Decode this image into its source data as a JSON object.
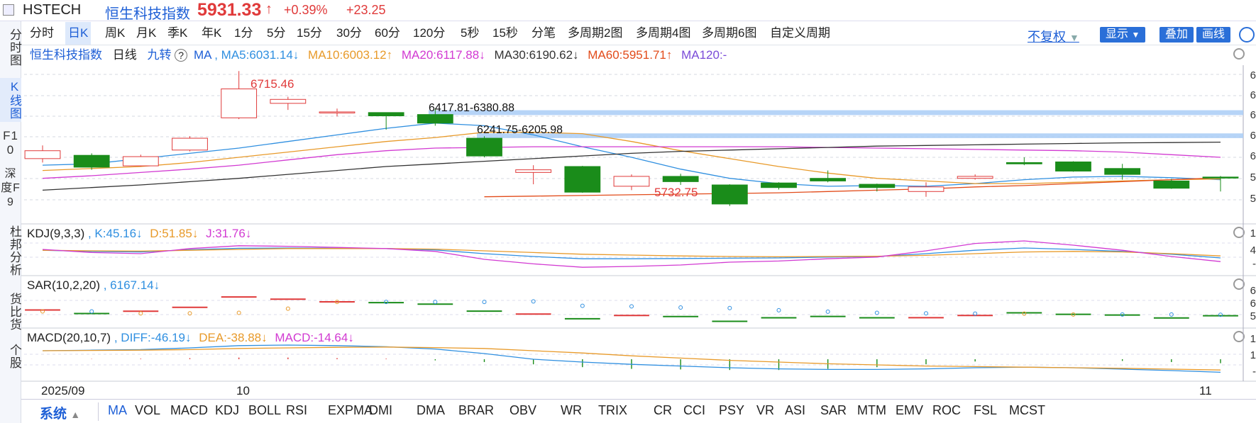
{
  "header": {
    "code": "HSTECH",
    "name": "恒生科技指数",
    "price": "5931.33",
    "price_arrow": "↑",
    "change_pct": "+0.39%",
    "change_val": "+23.25"
  },
  "sidebar": {
    "items": [
      "分时图",
      "K线图",
      "F10",
      "深度F9",
      "杜邦分析",
      "货比货",
      "个股"
    ]
  },
  "tabs": [
    "分时",
    "日K",
    "周K",
    "月K",
    "季K",
    "年K",
    "1分",
    "5分",
    "15分",
    "30分",
    "60分",
    "120分",
    "5秒",
    "15秒",
    "分笔",
    "多周期2图",
    "多周期4图",
    "多周期6图",
    "自定义周期"
  ],
  "toolbar": {
    "adjust": "不复权",
    "display": "显示",
    "overlay": "叠加",
    "draw": "画线"
  },
  "main_legend": {
    "name": "恒生科技指数",
    "period": "日线",
    "jiuzhuan": "九转",
    "help": "?",
    "ma": "MA",
    "ma5": ", MA5:6031.14↓",
    "ma10": "MA10:6003.12↑",
    "ma20": "MA20:6117.88↓",
    "ma30": "MA30:6190.62↓",
    "ma60": "MA60:5951.71↑",
    "ma120": "MA120:-"
  },
  "annotations": {
    "high": "6715.46",
    "low": "5732.75",
    "zone1": "6417.81-6380.88",
    "zone2": "6241.75-6205.98"
  },
  "kdj_legend": {
    "title": "KDJ(9,3,3)",
    "k": ", K:45.16↓",
    "d": "D:51.85↓",
    "j": "J:31.76↓"
  },
  "sar_legend": {
    "title": "SAR(10,2,20)",
    "value": ", 6167.14↓"
  },
  "macd_legend": {
    "title": "MACD(20,10,7)",
    "diff": ", DIFF:-46.19↓",
    "dea": "DEA:-38.88↓",
    "macd": "MACD:-14.64↓"
  },
  "date_axis": {
    "d1": "2025/09",
    "d2": "10",
    "d3": "11"
  },
  "axis_right": [
    "6",
    "6",
    "6",
    "6",
    "6",
    "5",
    "5",
    "1",
    "4",
    "-",
    "6",
    "6",
    "5",
    "1",
    "1",
    "-"
  ],
  "bottom": {
    "system": "系统",
    "indicators": [
      "MA",
      "VOL",
      "MACD",
      "KDJ",
      "BOLL",
      "RSI",
      "EXPMA",
      "DMI",
      "DMA",
      "BRAR",
      "OBV",
      "WR",
      "TRIX",
      "CR",
      "CCI",
      "PSY",
      "VR",
      "ASI",
      "SAR",
      "MTM",
      "EMV",
      "ROC",
      "FSL",
      "MCST"
    ]
  },
  "colors": {
    "up": "#e03a3a",
    "down": "#1a8c1a",
    "ma5": "#2f8fe0",
    "ma10": "#e89a2a",
    "ma20": "#d23ad2",
    "ma30": "#333333",
    "ma60": "#e24b1a",
    "ma120": "#7a4bd8",
    "accent": "#1e5fd6"
  },
  "chart_data": {
    "type": "candlestick",
    "candles": [
      {
        "o": 6050,
        "c": 6110,
        "h": 6150,
        "l": 6020
      },
      {
        "o": 6075,
        "c": 5985,
        "h": 6090,
        "l": 5965
      },
      {
        "o": 5995,
        "c": 6065,
        "h": 6080,
        "l": 5990
      },
      {
        "o": 6115,
        "c": 6205,
        "h": 6220,
        "l": 6105
      },
      {
        "o": 6360,
        "c": 6580,
        "h": 6715.46,
        "l": 6350
      },
      {
        "o": 6470,
        "c": 6500,
        "h": 6520,
        "l": 6420
      },
      {
        "o": 6400,
        "c": 6405,
        "h": 6430,
        "l": 6370
      },
      {
        "o": 6400,
        "c": 6375,
        "h": 6400,
        "l": 6270
      },
      {
        "o": 6385,
        "c": 6320,
        "h": 6430,
        "l": 6300
      },
      {
        "o": 6205,
        "c": 6070,
        "h": 6220,
        "l": 6060
      },
      {
        "o": 5945,
        "c": 5965,
        "h": 6000,
        "l": 5855
      },
      {
        "o": 5990,
        "c": 5795,
        "h": 5995,
        "l": 5790
      },
      {
        "o": 5840,
        "c": 5915,
        "h": 5930,
        "l": 5810
      },
      {
        "o": 5915,
        "c": 5875,
        "h": 5935,
        "l": 5850
      },
      {
        "o": 5850,
        "c": 5705,
        "h": 5855,
        "l": 5690
      },
      {
        "o": 5865,
        "c": 5830,
        "h": 5870,
        "l": 5815
      },
      {
        "o": 5900,
        "c": 5880,
        "h": 5960,
        "l": 5870
      },
      {
        "o": 5855,
        "c": 5830,
        "h": 5860,
        "l": 5800
      },
      {
        "o": 5800,
        "c": 5835,
        "h": 5870,
        "l": 5760
      },
      {
        "o": 5900,
        "c": 5915,
        "h": 5930,
        "l": 5890
      },
      {
        "o": 6020,
        "c": 6010,
        "h": 6060,
        "l": 6000
      },
      {
        "o": 6025,
        "c": 5955,
        "h": 6030,
        "l": 5950
      },
      {
        "o": 5975,
        "c": 5930,
        "h": 6010,
        "l": 5890
      },
      {
        "o": 5880,
        "c": 5825,
        "h": 5895,
        "l": 5820
      },
      {
        "o": 5910,
        "c": 5905,
        "h": 5918,
        "l": 5800
      }
    ],
    "ma5": [
      6000,
      6010,
      6050,
      6090,
      6130,
      6180,
      6230,
      6280,
      6320,
      6300,
      6230,
      6140,
      6060,
      5970,
      5900,
      5860,
      5840,
      5845,
      5840,
      5860,
      5890,
      5910,
      5915,
      5905,
      5890
    ],
    "ma10": [
      5960,
      5975,
      5990,
      6020,
      6060,
      6100,
      6140,
      6180,
      6210,
      6250,
      6250,
      6240,
      6180,
      6110,
      6050,
      5990,
      5940,
      5900,
      5880,
      5860,
      5860,
      5870,
      5880,
      5890,
      5895
    ],
    "ma20": [
      5900,
      5920,
      5945,
      5970,
      6000,
      6040,
      6080,
      6110,
      6130,
      6135,
      6140,
      6140,
      6140,
      6140,
      6140,
      6140,
      6135,
      6130,
      6125,
      6120,
      6115,
      6110,
      6100,
      6080,
      6060
    ],
    "ma30": [
      5810,
      5830,
      5850,
      5875,
      5900,
      5930,
      5960,
      5990,
      6010,
      6030,
      6050,
      6070,
      6090,
      6105,
      6115,
      6125,
      6135,
      6145,
      6150,
      6155,
      6160,
      6165,
      6170,
      6172,
      6175
    ],
    "ma60_start": 9,
    "ma60": [
      5760,
      5765,
      5770,
      5775,
      5780,
      5785,
      5790,
      5800,
      5810,
      5820,
      5835,
      5845,
      5860,
      5875,
      5890,
      5905
    ],
    "y_range": [
      5640,
      6760
    ],
    "zones": [
      [
        6380.88,
        6417.81
      ],
      [
        6205.98,
        6241.75
      ]
    ],
    "kdj": {
      "k": [
        72,
        68,
        66,
        74,
        79,
        80,
        79,
        78,
        73,
        60,
        50,
        42,
        42,
        43,
        44,
        45,
        48,
        50,
        60,
        72,
        80,
        75,
        68,
        58,
        45
      ],
      "d": [
        72,
        70,
        69,
        72,
        75,
        78,
        78,
        78,
        76,
        70,
        64,
        58,
        55,
        52,
        50,
        49,
        50,
        51,
        54,
        60,
        66,
        68,
        66,
        60,
        52
      ],
      "j": [
        75,
        64,
        60,
        78,
        88,
        86,
        82,
        78,
        68,
        40,
        24,
        12,
        15,
        20,
        30,
        34,
        42,
        48,
        70,
        96,
        105,
        90,
        72,
        50,
        32
      ]
    },
    "sar": [
      6060,
      6060,
      5990,
      5990,
      6010,
      6160,
      6400,
      6400,
      6400,
      6400,
      6420,
      6260,
      6240,
      6200,
      6180,
      6100,
      6050,
      6010,
      5990,
      5980,
      5980,
      5950,
      5950,
      5950,
      5940
    ],
    "macd": {
      "diff": [
        30,
        32,
        34,
        40,
        48,
        50,
        48,
        44,
        36,
        20,
        0,
        -10,
        -18,
        -24,
        -30,
        -34,
        -36,
        -36,
        -34,
        -30,
        -28,
        -30,
        -35,
        -40,
        -46
      ],
      "dea": [
        30,
        31,
        32,
        34,
        38,
        40,
        42,
        43,
        41,
        38,
        30,
        22,
        12,
        4,
        -4,
        -10,
        -16,
        -20,
        -24,
        -26,
        -28,
        -30,
        -32,
        -35,
        -38
      ],
      "hist": [
        0,
        1,
        2,
        4,
        6,
        6,
        4,
        2,
        -4,
        -10,
        -18,
        -28,
        -34,
        -36,
        -38,
        -38,
        -34,
        -28,
        -18,
        -8,
        0,
        0,
        -6,
        -10,
        -14
      ]
    }
  }
}
